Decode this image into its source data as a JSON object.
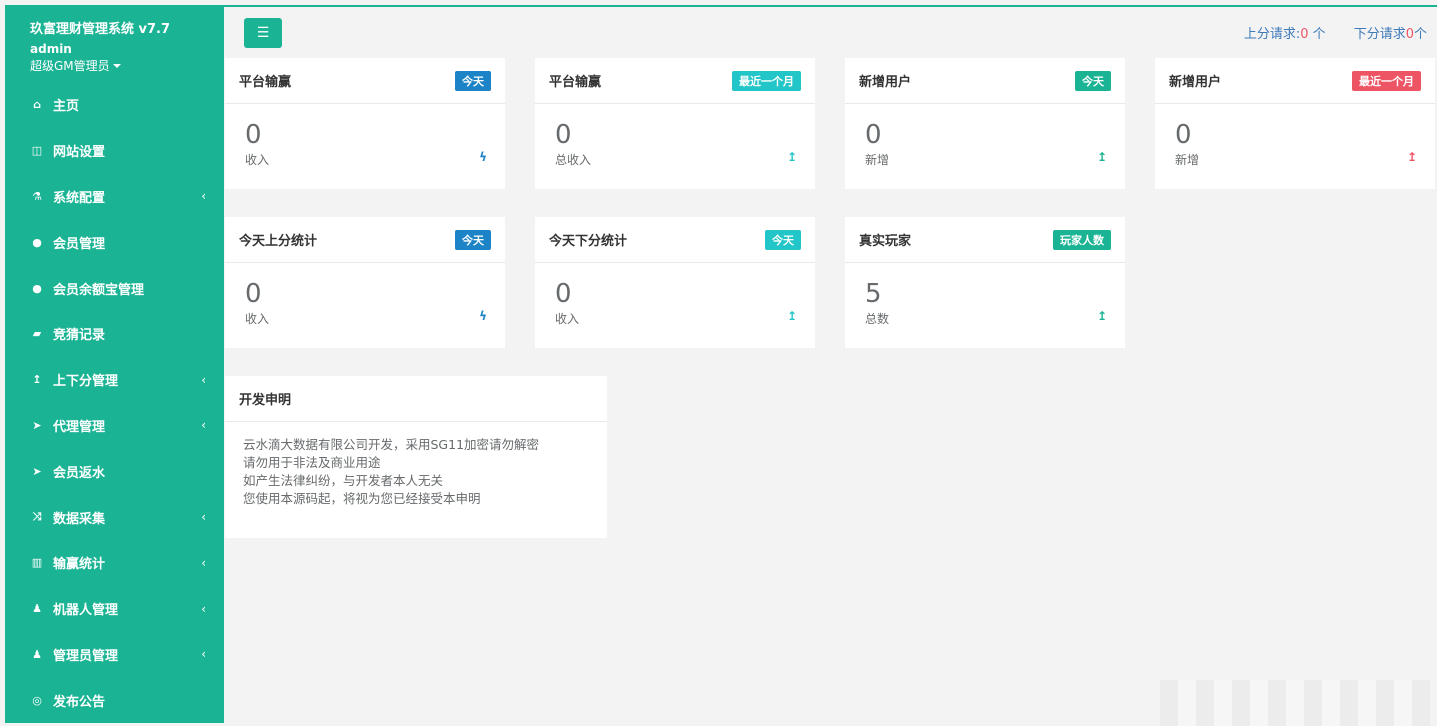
{
  "sidebar": {
    "app_title": "玖富理财管理系统 v7.7",
    "user_name": "admin",
    "role": "超级GM管理员",
    "items": [
      {
        "label": "主页",
        "icon": "home-icon",
        "glyph": "⌂",
        "arrow": ""
      },
      {
        "label": "网站设置",
        "icon": "columns-icon",
        "glyph": "◫",
        "arrow": ""
      },
      {
        "label": "系统配置",
        "icon": "flask-icon",
        "glyph": "⚗",
        "arrow": "‹"
      },
      {
        "label": "会员管理",
        "icon": "user-icon",
        "glyph": "●",
        "arrow": ""
      },
      {
        "label": "会员余额宝管理",
        "icon": "user-icon",
        "glyph": "●",
        "arrow": ""
      },
      {
        "label": "竞猜记录",
        "icon": "car-icon",
        "glyph": "▰",
        "arrow": ""
      },
      {
        "label": "上下分管理",
        "icon": "level-up-icon",
        "glyph": "↥",
        "arrow": "‹"
      },
      {
        "label": "代理管理",
        "icon": "paper-plane-icon",
        "glyph": "➤",
        "arrow": "‹"
      },
      {
        "label": "会员返水",
        "icon": "paper-plane-icon",
        "glyph": "➤",
        "arrow": ""
      },
      {
        "label": "数据采集",
        "icon": "random-icon",
        "glyph": "⤨",
        "arrow": "‹"
      },
      {
        "label": "输赢统计",
        "icon": "bar-chart-icon",
        "glyph": "▥",
        "arrow": "‹"
      },
      {
        "label": "机器人管理",
        "icon": "male-icon",
        "glyph": "♟",
        "arrow": "‹"
      },
      {
        "label": "管理员管理",
        "icon": "male-icon",
        "glyph": "♟",
        "arrow": "‹"
      },
      {
        "label": "发布公告",
        "icon": "comment-icon",
        "glyph": "◎",
        "arrow": ""
      }
    ]
  },
  "topbar": {
    "menu_icon": "bars-icon",
    "up_label": "上分请求:",
    "up_count": "0",
    "up_unit": " 个",
    "down_label": "下分请求",
    "down_count": "0",
    "down_unit": "个"
  },
  "cards": [
    {
      "title": "平台输赢",
      "badge": "今天",
      "badge_color": "#1c84c6",
      "value": "0",
      "sub": "收入",
      "trend_glyph": "ϟ",
      "trend_color": "#1c84c6",
      "trend_icon": "bolt-icon"
    },
    {
      "title": "平台输赢",
      "badge": "最近一个月",
      "badge_color": "#23c6c8",
      "value": "0",
      "sub": "总收入",
      "trend_glyph": "↥",
      "trend_color": "#23c6c8",
      "trend_icon": "level-up-icon"
    },
    {
      "title": "新增用户",
      "badge": "今天",
      "badge_color": "#1ab394",
      "value": "0",
      "sub": "新增",
      "trend_glyph": "↥",
      "trend_color": "#1ab394",
      "trend_icon": "level-up-icon"
    },
    {
      "title": "新增用户",
      "badge": "最近一个月",
      "badge_color": "#ed5565",
      "value": "0",
      "sub": "新增",
      "trend_glyph": "↥",
      "trend_color": "#ed5565",
      "trend_icon": "level-up-icon"
    },
    {
      "title": "今天上分统计",
      "badge": "今天",
      "badge_color": "#1c84c6",
      "value": "0",
      "sub": "收入",
      "trend_glyph": "ϟ",
      "trend_color": "#1c84c6",
      "trend_icon": "bolt-icon"
    },
    {
      "title": "今天下分统计",
      "badge": "今天",
      "badge_color": "#23c6c8",
      "value": "0",
      "sub": "收入",
      "trend_glyph": "↥",
      "trend_color": "#23c6c8",
      "trend_icon": "level-up-icon"
    },
    {
      "title": "真实玩家",
      "badge": "玩家人数",
      "badge_color": "#1ab394",
      "value": "5",
      "sub": "总数",
      "trend_glyph": "↥",
      "trend_color": "#1ab394",
      "trend_icon": "level-up-icon"
    }
  ],
  "notice": {
    "title": "开发申明",
    "lines": [
      "云水滴大数据有限公司开发，采用SG11加密请勿解密",
      "请勿用于非法及商业用途",
      "如产生法律纠纷，与开发者本人无关",
      "您使用本源码起，将视为您已经接受本申明"
    ]
  }
}
